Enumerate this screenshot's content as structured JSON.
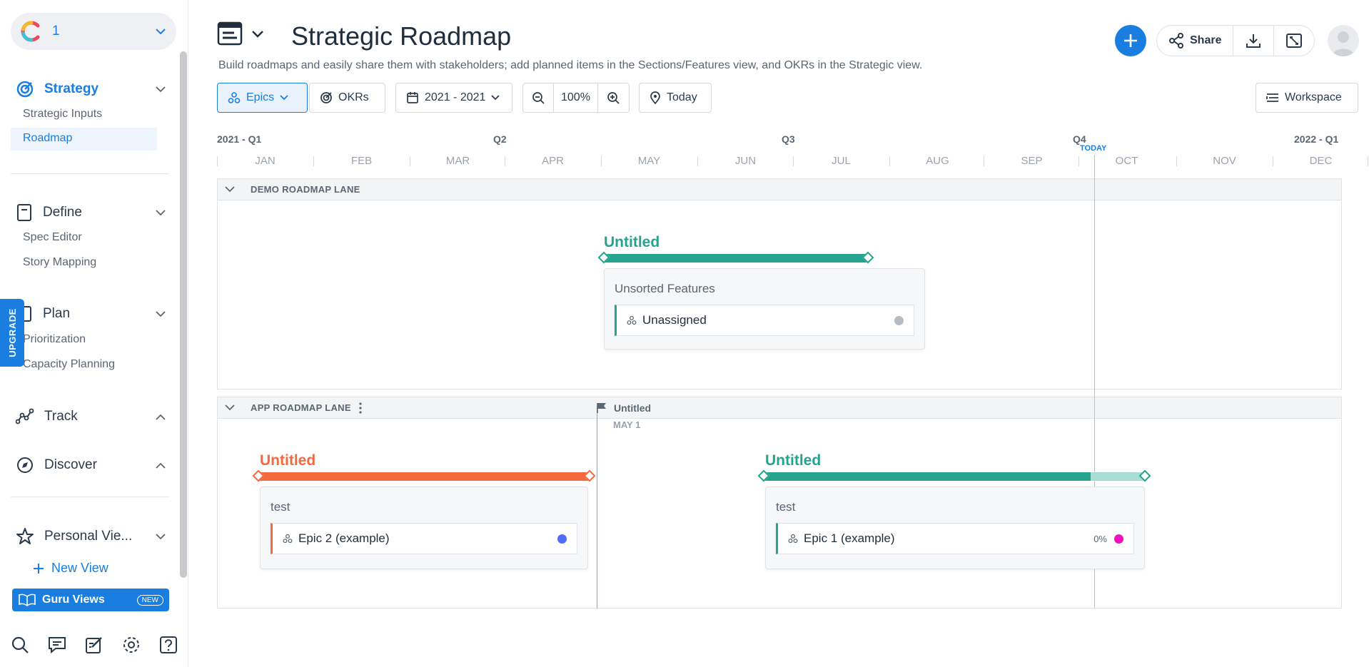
{
  "workspace": {
    "name": "1"
  },
  "sidebar": {
    "sections": {
      "strategy": {
        "label": "Strategy",
        "items": [
          "Strategic Inputs",
          "Roadmap"
        ]
      },
      "define": {
        "label": "Define",
        "items": [
          "Spec Editor",
          "Story Mapping"
        ]
      },
      "plan": {
        "label": "Plan",
        "items": [
          "Prioritization",
          "Capacity Planning"
        ]
      },
      "track": {
        "label": "Track"
      },
      "discover": {
        "label": "Discover"
      },
      "personal": {
        "label": "Personal Vie..."
      }
    },
    "upgrade_label": "UPGRADE",
    "new_view_label": "New View",
    "guru_views_label": "Guru Views",
    "guru_badge": "NEW"
  },
  "header": {
    "title": "Strategic Roadmap",
    "description": "Build roadmaps and easily share them with stakeholders; add planned items in the Sections/Features view, and OKRs in the Strategic view.",
    "share_label": "Share"
  },
  "toolbar": {
    "epics_label": "Epics",
    "okrs_label": "OKRs",
    "date_range": "2021 - 2021",
    "zoom": "100%",
    "today_label": "Today",
    "workspace_label": "Workspace"
  },
  "timeline": {
    "quarters": [
      "2021 - Q1",
      "Q2",
      "Q3",
      "Q4",
      "2022 - Q1"
    ],
    "months": [
      "JAN",
      "FEB",
      "MAR",
      "APR",
      "MAY",
      "JUN",
      "JUL",
      "AUG",
      "SEP",
      "OCT",
      "NOV",
      "DEC"
    ],
    "today_marker": "TODAY"
  },
  "lanes": {
    "demo": {
      "name": "DEMO ROADMAP LANE",
      "epic": {
        "title": "Untitled",
        "color": "#26a38f",
        "card_title": "Unsorted Features",
        "feature": {
          "name": "Unassigned",
          "dot_color": "#b7bcc2"
        }
      }
    },
    "app": {
      "name": "APP ROADMAP LANE",
      "milestone": {
        "label": "Untitled",
        "date": "MAY 1"
      },
      "epic_left": {
        "title": "Untitled",
        "color": "#f26a3d",
        "card_title": "test",
        "feature": {
          "name": "Epic 2 (example)",
          "dot_color": "#4f6ef7"
        }
      },
      "epic_right": {
        "title": "Untitled",
        "color": "#26a38f",
        "progress_color": "#a8ddd4",
        "card_title": "test",
        "feature": {
          "name": "Epic 1 (example)",
          "progress": "0%",
          "dot_color": "#f012be"
        }
      }
    }
  },
  "colors": {
    "accent": "#1a7de0",
    "teal": "#26a38f",
    "orange": "#f26a3d"
  }
}
